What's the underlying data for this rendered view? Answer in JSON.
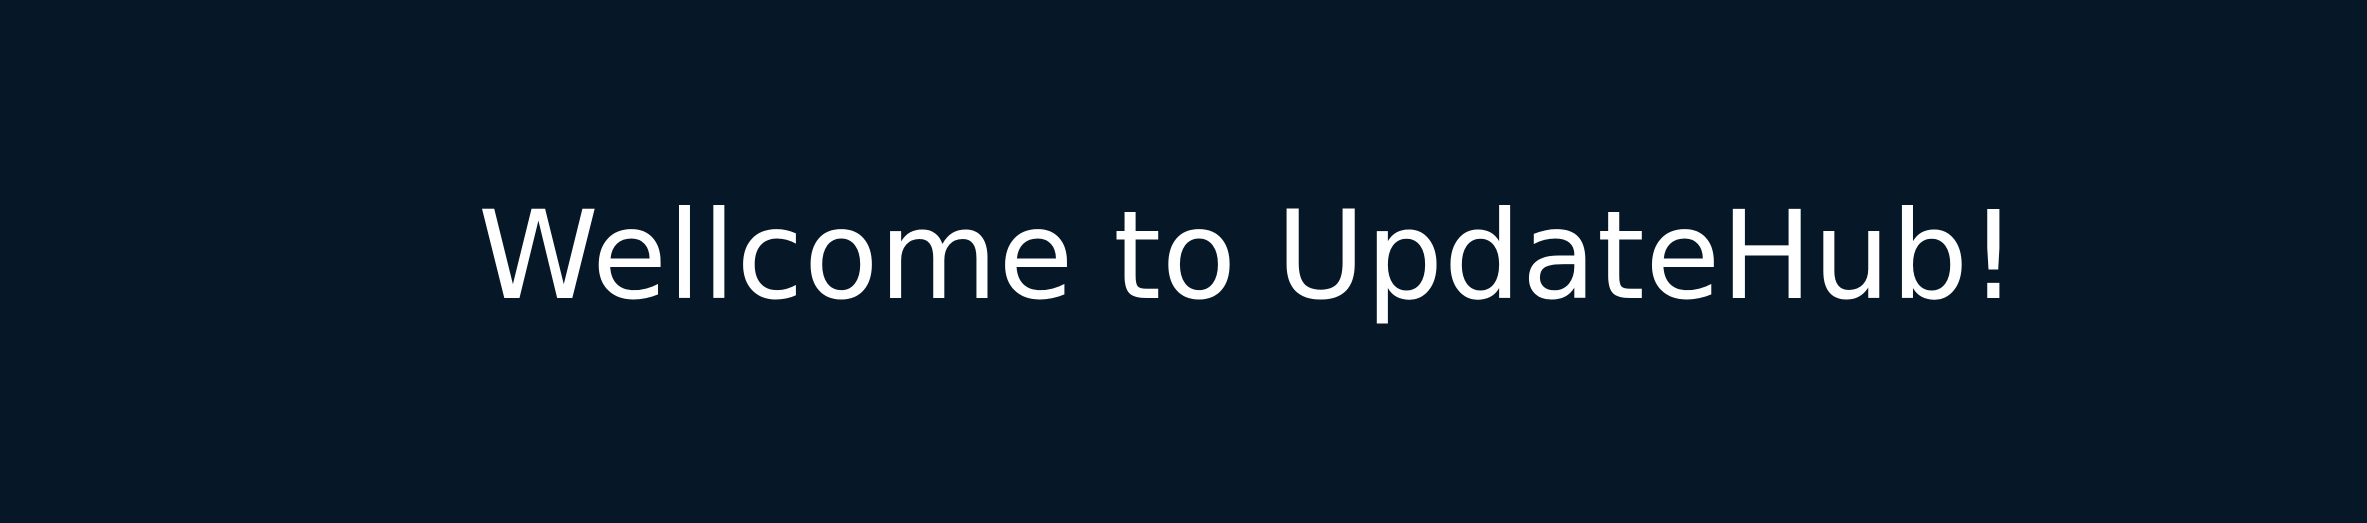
{
  "welcome": {
    "message": "Wellcome to UpdateHub!"
  },
  "colors": {
    "background": "#061828",
    "text": "#ffffff"
  }
}
